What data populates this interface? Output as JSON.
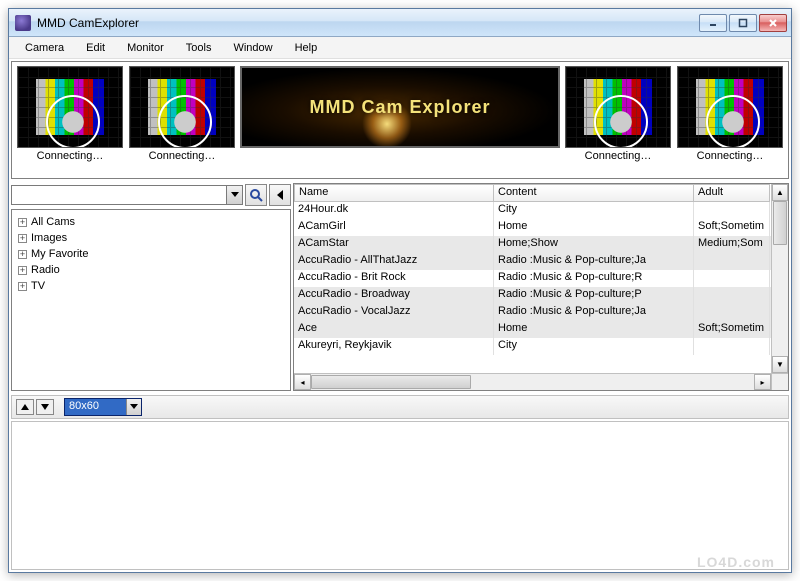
{
  "window": {
    "title": "MMD CamExplorer"
  },
  "menu": {
    "items": [
      "Camera",
      "Edit",
      "Monitor",
      "Tools",
      "Window",
      "Help"
    ]
  },
  "thumbnails": {
    "connecting_label": "Connecting…",
    "banner_text": "MMD Cam Explorer",
    "items": [
      {
        "type": "test",
        "label": "Connecting…"
      },
      {
        "type": "test",
        "label": "Connecting…"
      },
      {
        "type": "banner"
      },
      {
        "type": "test",
        "label": "Connecting…"
      },
      {
        "type": "test",
        "label": "Connecting…"
      }
    ]
  },
  "search": {
    "value": "",
    "icons": {
      "search": "search-icon",
      "collapse": "collapse-arrow-icon"
    }
  },
  "tree": {
    "items": [
      {
        "label": "All Cams",
        "expandable": true
      },
      {
        "label": "Images",
        "expandable": true
      },
      {
        "label": "My Favorite",
        "expandable": true
      },
      {
        "label": "Radio",
        "expandable": true
      },
      {
        "label": "TV",
        "expandable": true
      }
    ]
  },
  "table": {
    "columns": [
      "Name",
      "Content",
      "Adult"
    ],
    "rows": [
      {
        "name": "24Hour.dk",
        "content": "City",
        "adult": ""
      },
      {
        "name": "ACamGirl",
        "content": "Home",
        "adult": "Soft;Sometim"
      },
      {
        "name": "ACamStar",
        "content": "Home;Show",
        "adult": "Medium;Som"
      },
      {
        "name": "AccuRadio - AllThatJazz",
        "content": "Radio :Music & Pop-culture;Ja",
        "adult": ""
      },
      {
        "name": "AccuRadio - Brit Rock",
        "content": "Radio :Music & Pop-culture;R",
        "adult": ""
      },
      {
        "name": "AccuRadio - Broadway",
        "content": "Radio :Music & Pop-culture;P",
        "adult": ""
      },
      {
        "name": "AccuRadio - VocalJazz",
        "content": "Radio :Music & Pop-culture;Ja",
        "adult": ""
      },
      {
        "name": "Ace",
        "content": "Home",
        "adult": "Soft;Sometim"
      },
      {
        "name": "Akureyri, Reykjavik",
        "content": "City",
        "adult": ""
      }
    ]
  },
  "size_selector": {
    "value": "80x60"
  },
  "watermark": "LO4D.com"
}
